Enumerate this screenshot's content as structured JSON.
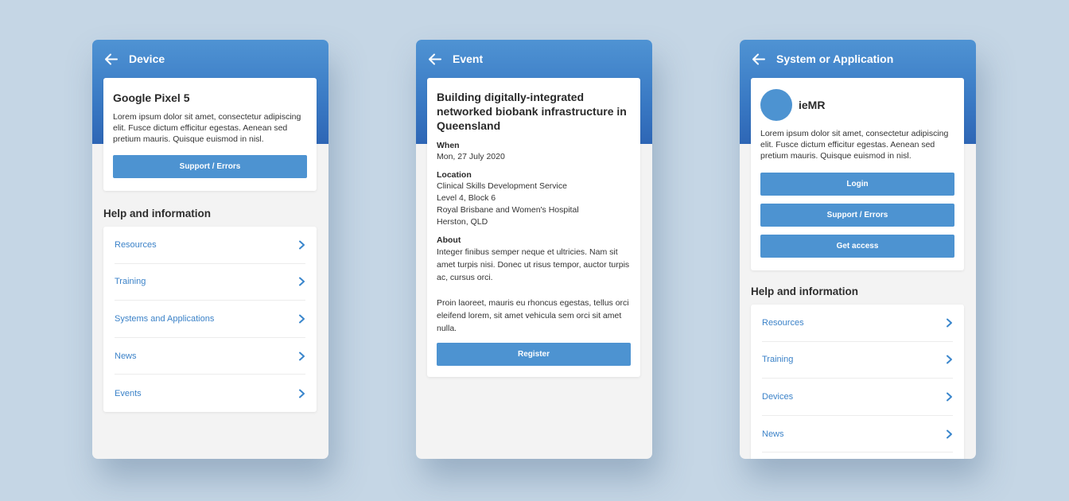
{
  "colors": {
    "background": "#c5d6e5",
    "header": "#3979c4",
    "accent": "#4d93d1",
    "link": "#3b82c8",
    "chevron": "#3a86cc"
  },
  "device": {
    "appbar": {
      "back_icon": "arrow-left-icon",
      "title": "Device"
    },
    "card": {
      "title": "Google Pixel 5",
      "body": "Lorem ipsum dolor sit amet, consectetur adipiscing elit. Fusce dictum efficitur egestas. Aenean sed pretium mauris. Quisque euismod in nisl.",
      "button": "Support / Errors"
    },
    "help": {
      "heading": "Help and information",
      "items": [
        {
          "label": "Resources"
        },
        {
          "label": "Training"
        },
        {
          "label": "Systems and Applications"
        },
        {
          "label": "News"
        },
        {
          "label": "Events"
        }
      ]
    }
  },
  "event": {
    "appbar": {
      "back_icon": "arrow-left-icon",
      "title": "Event"
    },
    "card": {
      "title": "Building digitally-integrated networked biobank infrastructure in Queensland",
      "when_label": "When",
      "when_value": "Mon, 27 July 2020",
      "location_label": "Location",
      "location_lines": [
        "Clinical Skills Development Service",
        "Level 4, Block 6",
        "Royal Brisbane and Women's Hospital",
        "Herston, QLD"
      ],
      "about_label": "About",
      "about_paragraphs": [
        "Integer finibus semper neque et ultricies. Nam sit amet turpis nisi. Donec ut risus tempor, auctor turpis ac, cursus orci.",
        "Proin laoreet, mauris eu rhoncus egestas, tellus orci eleifend lorem, sit amet vehicula sem orci sit amet nulla."
      ],
      "button": "Register"
    }
  },
  "system": {
    "appbar": {
      "back_icon": "arrow-left-icon",
      "title": "System or Application"
    },
    "card": {
      "name": "ieMR",
      "body": "Lorem ipsum dolor sit amet, consectetur adipiscing elit. Fusce dictum efficitur egestas. Aenean sed pretium mauris. Quisque euismod in nisl.",
      "buttons": [
        "Login",
        "Support / Errors",
        "Get access"
      ]
    },
    "help": {
      "heading": "Help and information",
      "items": [
        {
          "label": "Resources"
        },
        {
          "label": "Training"
        },
        {
          "label": "Devices"
        },
        {
          "label": "News"
        }
      ]
    }
  }
}
